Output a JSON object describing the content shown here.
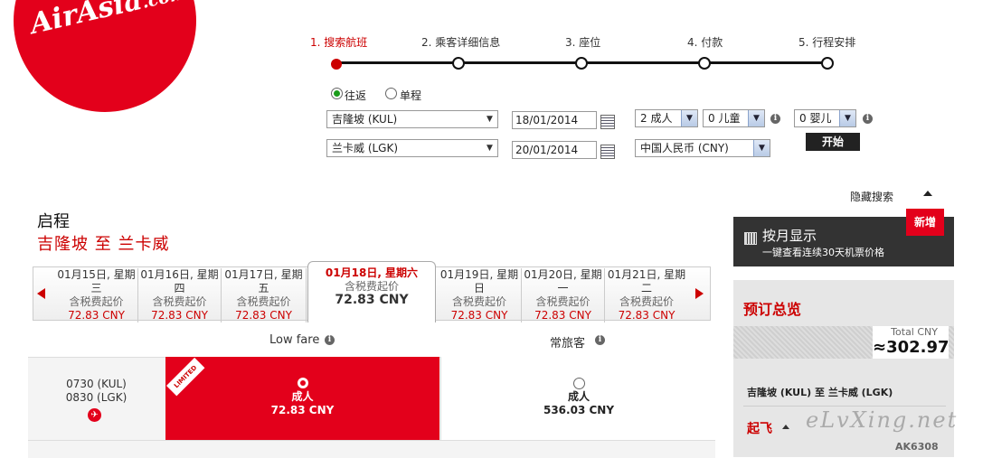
{
  "logo": {
    "text_main": "AirAsia",
    "text_suffix": ".com"
  },
  "steps": [
    {
      "label": "1. 搜索航班"
    },
    {
      "label": "2. 乘客详细信息"
    },
    {
      "label": "3. 座位"
    },
    {
      "label": "4. 付款"
    },
    {
      "label": "5. 行程安排"
    }
  ],
  "search": {
    "trip_types": [
      {
        "label": "往返",
        "selected": true
      },
      {
        "label": "单程",
        "selected": false
      }
    ],
    "origin": "吉隆坡 (KUL)",
    "destination": "兰卡威 (LGK)",
    "depart_date": "18/01/2014",
    "return_date": "20/01/2014",
    "adults": "2 成人",
    "children": "0 儿童",
    "infants": "0 婴儿",
    "currency": "中国人民币 (CNY)",
    "go_button": "开始",
    "hide_search": "隐藏搜索",
    "info_icon": "i"
  },
  "results": {
    "heading": "启程",
    "route": "吉隆坡 至 兰卡威",
    "dates": [
      {
        "date": "01月15日, 星期",
        "weekday": "三",
        "sub": "含税费起价",
        "price": "72.83 CNY"
      },
      {
        "date": "01月16日, 星期",
        "weekday": "四",
        "sub": "含税费起价",
        "price": "72.83 CNY"
      },
      {
        "date": "01月17日, 星期",
        "weekday": "五",
        "sub": "含税费起价",
        "price": "72.83 CNY"
      },
      {
        "date": "01月18日, 星期六",
        "weekday": "",
        "sub": "含税费起价",
        "price": "72.83 CNY"
      },
      {
        "date": "01月19日, 星期",
        "weekday": "日",
        "sub": "含税费起价",
        "price": "72.83 CNY"
      },
      {
        "date": "01月20日, 星期",
        "weekday": "一",
        "sub": "含税费起价",
        "price": "72.83 CNY"
      },
      {
        "date": "01月21日, 星期",
        "weekday": "二",
        "sub": "含税费起价",
        "price": "72.83 CNY"
      }
    ],
    "fare_headers": {
      "low": "Low fare",
      "frequent": "常旅客"
    },
    "flight": {
      "depart": "0730 (KUL)",
      "arrive": "0830 (LGK)",
      "ribbon": "LIMITED",
      "low_fare": {
        "label": "成人",
        "price": "72.83 CNY"
      },
      "frequent_fare": {
        "label": "成人",
        "price": "536.03 CNY"
      }
    }
  },
  "sidebar": {
    "monthly_title": "按月显示",
    "monthly_sub": "一键查看连续30天机票价格",
    "new_badge": "新增",
    "summary_title": "预订总览",
    "total_label": "Total CNY",
    "total_value": "≈302.97",
    "route": "吉隆坡 (KUL) 至 兰卡威 (LGK)",
    "depart_label": "起飞",
    "flight_code": "AK6308",
    "watermark": "eLvXing.net"
  },
  "colors": {
    "brand_red": "#e3001b",
    "dark": "#333333"
  }
}
